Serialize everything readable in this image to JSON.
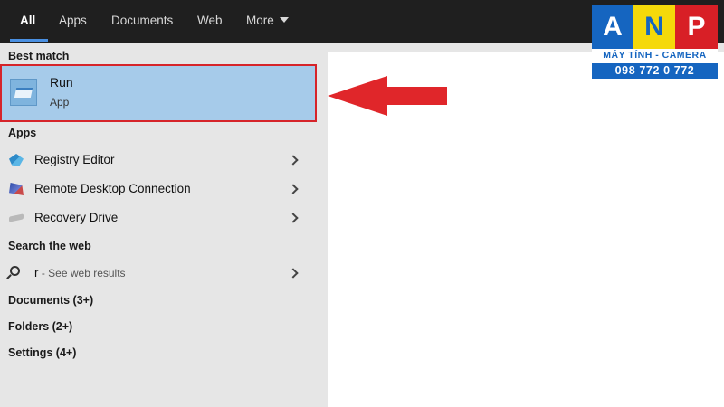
{
  "tabs": [
    {
      "label": "All",
      "active": true
    },
    {
      "label": "Apps"
    },
    {
      "label": "Documents"
    },
    {
      "label": "Web"
    },
    {
      "label": "More"
    }
  ],
  "best_match": {
    "heading": "Best match",
    "title": "Run",
    "subtitle": "App"
  },
  "apps": {
    "heading": "Apps",
    "items": [
      {
        "label": "Registry Editor",
        "icon": "registry-editor-icon"
      },
      {
        "label": "Remote Desktop Connection",
        "icon": "remote-desktop-icon"
      },
      {
        "label": "Recovery Drive",
        "icon": "recovery-drive-icon"
      }
    ]
  },
  "web": {
    "heading": "Search the web",
    "query": "r",
    "hint": " - See web results"
  },
  "more_sections": [
    {
      "label": "Documents (3+)"
    },
    {
      "label": "Folders (2+)"
    },
    {
      "label": "Settings (4+)"
    }
  ],
  "logo": {
    "letters": [
      "A",
      "N",
      "P"
    ],
    "tagline": "MÁY TÍNH - CAMERA",
    "phone": "098 772 0 772"
  },
  "colors": {
    "topbar": "#1f1f1f",
    "selection": "#a6cbea",
    "highlight_border": "#d6242a",
    "arrow": "#e0262a",
    "brand_blue": "#1565c0",
    "brand_yellow": "#f5d90a",
    "brand_red": "#d81f26"
  }
}
